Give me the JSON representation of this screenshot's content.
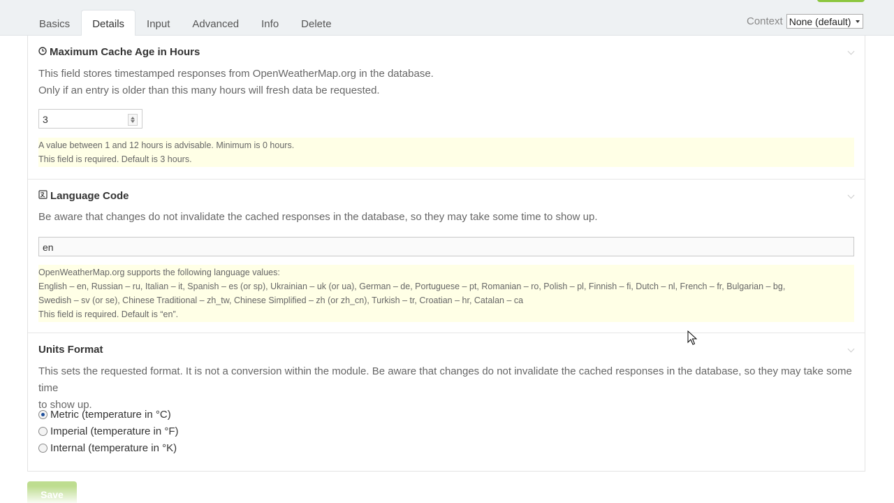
{
  "tabs": [
    "Basics",
    "Details",
    "Input",
    "Advanced",
    "Info",
    "Delete"
  ],
  "active_tab": "Details",
  "context": {
    "label": "Context",
    "value": "None (default)"
  },
  "sections": {
    "cache": {
      "icon": "clock-icon",
      "title": "Maximum Cache Age in Hours",
      "desc": [
        "This field stores timestamped responses from OpenWeatherMap.org in the database.",
        "Only if an entry is older than this many hours will fresh data be requested."
      ],
      "value": "3",
      "note": [
        "A value between 1 and 12 hours is advisable. Minimum is 0 hours.",
        "This field is required. Default is 3 hours."
      ]
    },
    "language": {
      "icon": "translate-icon",
      "title": "Language Code",
      "desc": "Be aware that changes do not invalidate the cached responses in the database, so they may take some time to show up.",
      "value": "en",
      "note": [
        "OpenWeatherMap.org supports the following language values:",
        "English – en, Russian – ru, Italian – it, Spanish – es (or sp), Ukrainian – uk (or ua), German – de, Portuguese – pt, Romanian – ro, Polish – pl, Finnish – fi, Dutch – nl, French – fr, Bulgarian – bg,",
        "Swedish – sv (or se), Chinese Traditional – zh_tw, Chinese Simplified – zh (or zh_cn), Turkish – tr, Croatian – hr, Catalan – ca",
        "This field is required. Default is “en”."
      ]
    },
    "units": {
      "title": "Units Format",
      "desc": [
        "This sets the requested format. It is not a conversion within the module. Be aware that changes do not invalidate the cached responses in the database, so they may take some time",
        "to show up."
      ],
      "options": [
        {
          "label": "Metric (temperature in °C)",
          "checked": true
        },
        {
          "label": "Imperial (temperature in °F)",
          "checked": false
        },
        {
          "label": "Internal (temperature in °K)",
          "checked": false
        }
      ]
    }
  },
  "save_label": "Save",
  "colors": {
    "accent_green": "#8cc63f",
    "note_bg": "#ffffe6",
    "radio_checked": "#1e4f9b"
  }
}
